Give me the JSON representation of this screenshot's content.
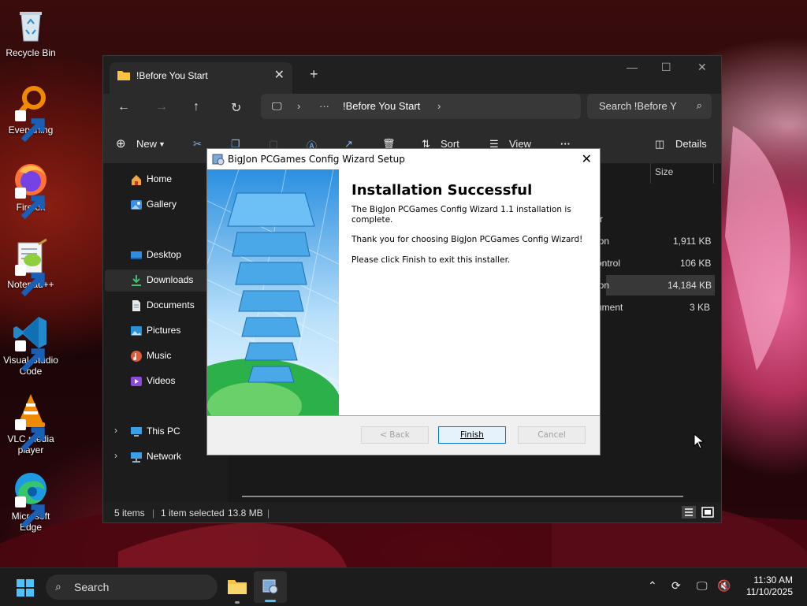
{
  "desktop": {
    "icons": [
      {
        "label": "Recycle Bin",
        "icon": "recycle-bin-icon"
      },
      {
        "label": "Everything",
        "icon": "everything-search-icon"
      },
      {
        "label": "Firefox",
        "icon": "firefox-icon"
      },
      {
        "label": "Notepad++",
        "icon": "notepadpp-icon"
      },
      {
        "label": "Visual Studio Code",
        "icon": "vscode-icon"
      },
      {
        "label": "VLC media player",
        "icon": "vlc-icon"
      },
      {
        "label": "Microsoft Edge",
        "icon": "edge-icon"
      }
    ]
  },
  "explorer": {
    "tab_title": "!Before You Start",
    "new_tab_glyph": "+",
    "breadcrumb": {
      "more": "···",
      "current": "!Before You Start"
    },
    "search_placeholder": "Search !Before Y",
    "toolbar": {
      "new": "New",
      "sort": "Sort",
      "view": "View",
      "more": "···",
      "details": "Details"
    },
    "sidebar": [
      {
        "label": "Home",
        "icon": "home-icon"
      },
      {
        "label": "Gallery",
        "icon": "gallery-icon"
      },
      {
        "label": "Desktop",
        "icon": "desktop-folder-icon"
      },
      {
        "label": "Downloads",
        "icon": "downloads-icon"
      },
      {
        "label": "Documents",
        "icon": "documents-icon"
      },
      {
        "label": "Pictures",
        "icon": "pictures-icon"
      },
      {
        "label": "Music",
        "icon": "music-icon"
      },
      {
        "label": "Videos",
        "icon": "videos-icon"
      },
      {
        "label": "This PC",
        "icon": "this-pc-icon"
      },
      {
        "label": "Network",
        "icon": "network-icon"
      }
    ],
    "columns": {
      "size": "Size"
    },
    "rows": [
      {
        "type_fragment": "r",
        "size": ""
      },
      {
        "type_fragment": "ion",
        "size": "1,911 KB"
      },
      {
        "type_fragment": "ontrol",
        "size": "106 KB"
      },
      {
        "type_fragment": "ion",
        "size": "14,184 KB"
      },
      {
        "type_fragment": "ument",
        "size": "3 KB"
      }
    ],
    "status": {
      "items": "5 items",
      "selected": "1 item selected",
      "size": "13.8 MB",
      "sep": "|"
    }
  },
  "wizard": {
    "title": "BigJon PCGames Config Wizard Setup",
    "heading": "Installation Successful",
    "p1": "The BigJon PCGames Config Wizard 1.1 installation is complete.",
    "p2": "Thank you for choosing BigJon PCGames Config Wizard!",
    "p3": "Please click Finish to exit this installer.",
    "buttons": {
      "back": "< Back",
      "finish": "Finish",
      "cancel": "Cancel"
    }
  },
  "taskbar": {
    "search": "Search",
    "time": "11:30 AM",
    "date": "11/10/2025"
  }
}
